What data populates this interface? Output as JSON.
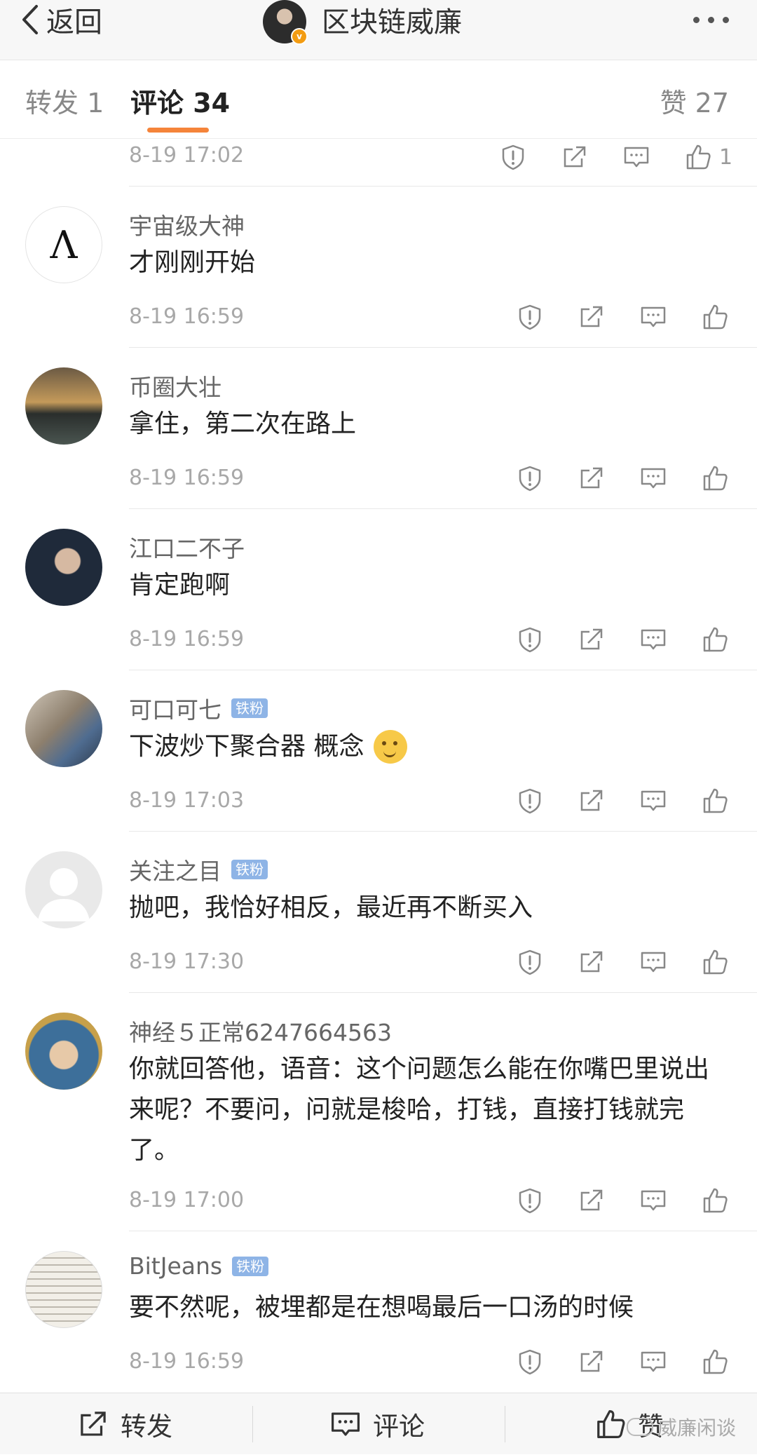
{
  "header": {
    "back_label": "返回",
    "title": "区块链威廉",
    "verified_mark": "v"
  },
  "tabs": {
    "repost": "转发 1",
    "comment": "评论 34",
    "like": "赞 27"
  },
  "top_partial": {
    "time": "8-19 17:02",
    "like_count": "1"
  },
  "comments": [
    {
      "name": "宇宙级大神",
      "badge": "",
      "text": "才刚刚开始",
      "time": "8-19 16:59",
      "avatar_glyph": "Λ"
    },
    {
      "name": "币圈大壮",
      "badge": "",
      "text": "拿住，第二次在路上",
      "time": "8-19 16:59"
    },
    {
      "name": "江口二不子",
      "badge": "",
      "text": "肯定跑啊",
      "time": "8-19 16:59"
    },
    {
      "name": "可口可七",
      "badge": "铁粉",
      "text": "下波炒下聚合器 概念",
      "time": "8-19 17:03"
    },
    {
      "name": "关注之目",
      "badge": "铁粉",
      "text": "抛吧，我恰好相反，最近再不断买入",
      "time": "8-19 17:30"
    },
    {
      "name": "神经５正常6247664563",
      "badge": "",
      "text": "你就回答他，语音：这个问题怎么能在你嘴巴里说出来呢？不要问，问就是梭哈，打钱，直接打钱就完了。",
      "time": "8-19 17:00"
    },
    {
      "name": "BitJeans",
      "badge": "铁粉",
      "text": "要不然呢，被埋都是在想喝最后一口汤的时候",
      "time": "8-19 16:59"
    }
  ],
  "bottom_bar": {
    "repost": "转发",
    "comment": "评论",
    "like": "赞",
    "watermark": "威廉闲谈"
  },
  "icons": [
    "chevron-left-icon",
    "more-dots-icon",
    "report-icon",
    "share-icon",
    "comment-icon",
    "thumbs-up-icon"
  ],
  "colors": {
    "accent": "#f5843a",
    "badge": "#8eb4e6",
    "verified": "#f39c12"
  }
}
